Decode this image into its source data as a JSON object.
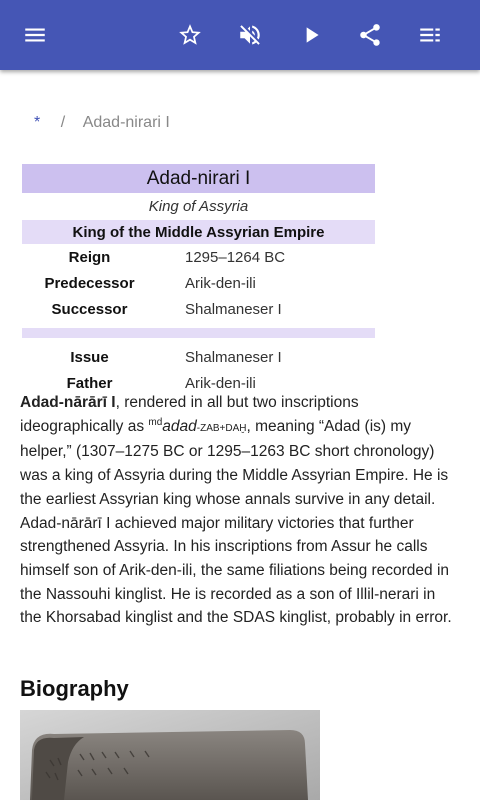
{
  "toolbar": {
    "menu_icon": "hamburger-menu-icon",
    "star_icon": "star-outline-icon",
    "mute_icon": "volume-off-icon",
    "play_icon": "play-icon",
    "share_icon": "share-icon",
    "list_icon": "playlist-icon",
    "color": "#4556b5"
  },
  "breadcrumb": {
    "home": "*",
    "separator": "/",
    "current": "Adad-nirari I"
  },
  "infobox": {
    "title": "Adad-nirari I",
    "subtitle": "King of Assyria",
    "section": "King of the Middle Assyrian Empire",
    "rows": [
      {
        "key": "Reign",
        "value": "1295–1264 BC"
      },
      {
        "key": "Predecessor",
        "value": "Arik-den-ili"
      },
      {
        "key": "Successor",
        "value": "Shalmaneser I"
      }
    ],
    "rows2": [
      {
        "key": "Issue",
        "value": "Shalmaneser I"
      },
      {
        "key": "Father",
        "value": "Arik-den-ili"
      }
    ]
  },
  "article": {
    "bold_name": "Adad-nārārī I",
    "p1a": ", rendered in all but two inscriptions ideographically as ",
    "sup": "md",
    "ital": "adad",
    "sc": "-ZAB+DAḪ",
    "p1b": ", meaning “Adad (is) my helper,” (1307–1275 BC or 1295–1263 BC short chronology) was a king of Assyria during the Middle Assyrian Empire. He is the earliest Assyrian king whose annals survive in any detail. Adad-nārārī I achieved major military victories that further strengthened Assyria. In his inscriptions from Assur he calls himself son of Arik-den-ili, the same filiations being recorded in the Nassouhi kinglist. He is recorded as a son of Illil-nerari in the Khorsabad kinglist and the SDAS kinglist, probably in error."
  },
  "section_heading": "Biography"
}
